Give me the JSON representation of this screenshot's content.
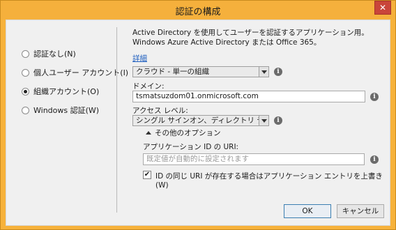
{
  "window": {
    "title": "認証の構成",
    "close_label": "✕"
  },
  "auth_options": [
    {
      "label": "認証なし(N)",
      "checked": false
    },
    {
      "label": "個人ユーザー アカウント(I)",
      "checked": false
    },
    {
      "label": "組織アカウント(O)",
      "checked": true
    },
    {
      "label": "Windows 認証(W)",
      "checked": false
    }
  ],
  "description": "Active Directory を使用してユーザーを認証するアプリケーション用。Windows Azure Active Directory または Office 365。",
  "details_link": "詳細",
  "org_type": {
    "value": "クラウド - 単一の組織"
  },
  "domain": {
    "label": "ドメイン:",
    "value": "tsmatsuzdom01.onmicrosoft.com"
  },
  "access_level": {
    "label": "アクセス レベル:",
    "value": "シングル サインオン、ディレクトリ データの読み取"
  },
  "more_options": {
    "label": "その他のオプション"
  },
  "app_id_uri": {
    "label": "アプリケーション ID の URI:",
    "placeholder": "既定値が自動的に設定されます"
  },
  "overwrite": {
    "label": "ID の同じ URI が存在する場合はアプリケーション エントリを上書き(W)",
    "checked": true
  },
  "buttons": {
    "ok": "OK",
    "cancel": "キャンセル"
  },
  "icons": {
    "info": "info-icon",
    "dropdown": "chevron-down-icon",
    "collapse": "chevron-up-icon"
  }
}
